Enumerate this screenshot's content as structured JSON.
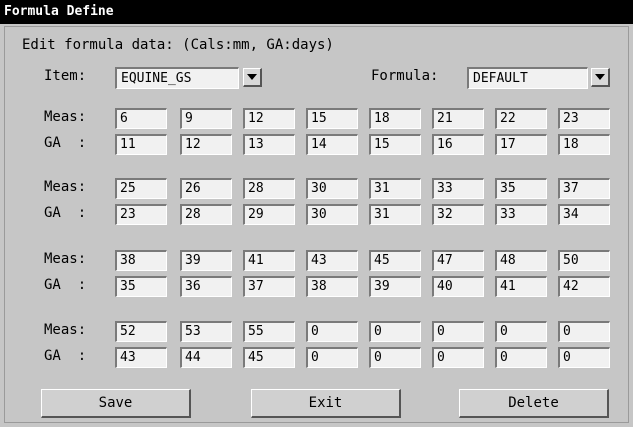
{
  "window": {
    "title": "Formula Define"
  },
  "header": {
    "subtitle": "Edit formula data: (Cals:mm, GA:days)"
  },
  "item": {
    "label": "Item:",
    "value": "EQUINE_GS"
  },
  "formula": {
    "label": "Formula:",
    "value": "DEFAULT"
  },
  "labels": {
    "meas": "Meas:",
    "ga": "GA  :"
  },
  "groups": [
    {
      "meas": [
        "6",
        "9",
        "12",
        "15",
        "18",
        "21",
        "22",
        "23"
      ],
      "ga": [
        "11",
        "12",
        "13",
        "14",
        "15",
        "16",
        "17",
        "18"
      ]
    },
    {
      "meas": [
        "25",
        "26",
        "28",
        "30",
        "31",
        "33",
        "35",
        "37"
      ],
      "ga": [
        "23",
        "28",
        "29",
        "30",
        "31",
        "32",
        "33",
        "34"
      ]
    },
    {
      "meas": [
        "38",
        "39",
        "41",
        "43",
        "45",
        "47",
        "48",
        "50"
      ],
      "ga": [
        "35",
        "36",
        "37",
        "38",
        "39",
        "40",
        "41",
        "42"
      ]
    },
    {
      "meas": [
        "52",
        "53",
        "55",
        "0",
        "0",
        "0",
        "0",
        "0"
      ],
      "ga": [
        "43",
        "44",
        "45",
        "0",
        "0",
        "0",
        "0",
        "0"
      ]
    }
  ],
  "buttons": {
    "save": "Save",
    "exit": "Exit",
    "delete": "Delete"
  },
  "icons": {
    "dropdown": "chevron-down-icon"
  }
}
